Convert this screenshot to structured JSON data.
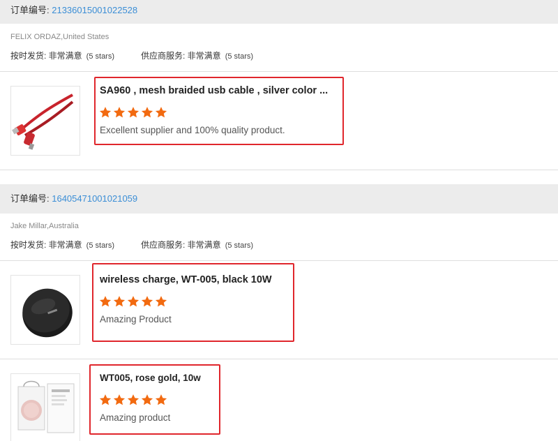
{
  "orders": [
    {
      "order_label": "订单编号: ",
      "order_no": "21336015001022528",
      "buyer": "FELIX ORDAZ,United States",
      "delivery_label": "按时发货: 非常满意",
      "delivery_stars": "(5 stars)",
      "service_label": "供应商服务: 非常满意",
      "service_stars": "(5 stars)",
      "products": [
        {
          "title": "SA960 , mesh braided usb cable , silver color ...",
          "rating": 5,
          "comment": "Excellent supplier and 100% quality product.",
          "image": "red-usb-cable"
        }
      ]
    },
    {
      "order_label": "订单编号: ",
      "order_no": "16405471001021059",
      "buyer": "Jake Millar,Australia",
      "delivery_label": "按时发货: 非常满意",
      "delivery_stars": "(5 stars)",
      "service_label": "供应商服务: 非常满意",
      "service_stars": "(5 stars)",
      "products": [
        {
          "title": "wireless charge, WT-005, black 10W",
          "rating": 5,
          "comment": "Amazing Product",
          "image": "black-wireless-charger"
        },
        {
          "title": "WT005, rose gold, 10w",
          "rating": 5,
          "comment": "Amazing product",
          "image": "rose-gold-charger-box"
        }
      ]
    }
  ],
  "colors": {
    "accent_link": "#3b8ed6",
    "star": "#f26a10",
    "highlight_border": "#e0262c"
  }
}
